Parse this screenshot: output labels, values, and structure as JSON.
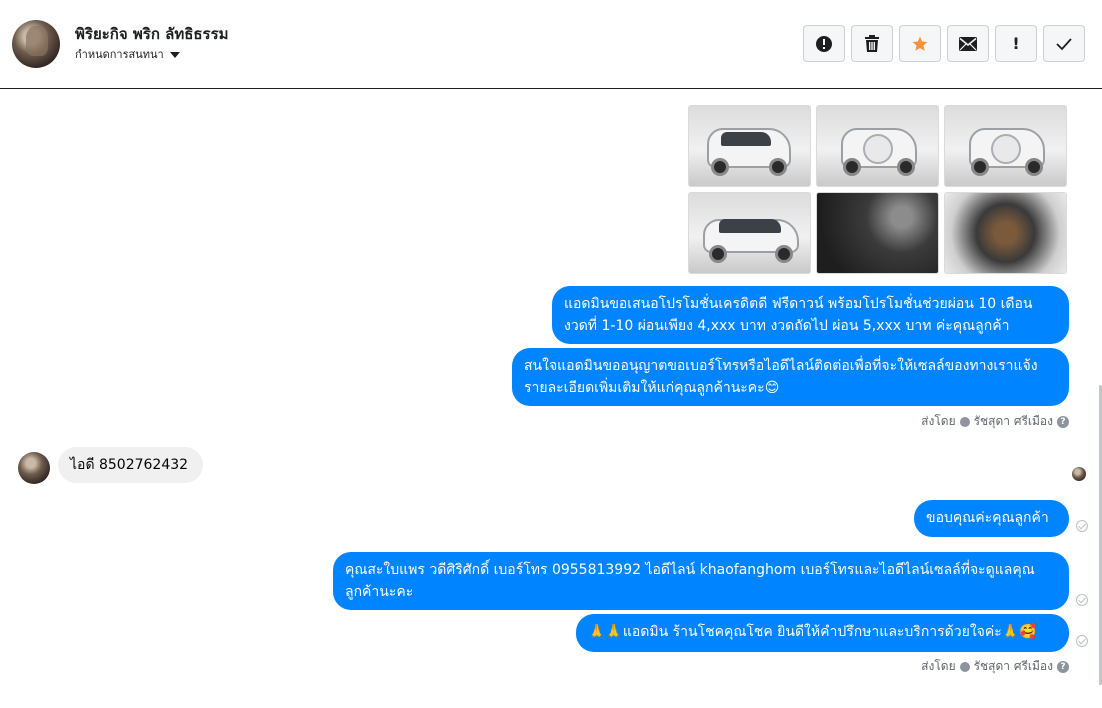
{
  "header": {
    "contact_name": "พิริยะกิจ พริก ลัทธิธรรม",
    "assign_label": "กำหนดการสนทนา",
    "toolbar": [
      {
        "icon": "alert-circle-icon"
      },
      {
        "icon": "trash-icon"
      },
      {
        "icon": "star-icon",
        "color": "#f7923a"
      },
      {
        "icon": "envelope-icon"
      },
      {
        "icon": "exclamation-icon",
        "text": "!"
      },
      {
        "icon": "checkmark-icon"
      }
    ]
  },
  "thread": {
    "photos": [
      {
        "name": "car-front-left-photo"
      },
      {
        "name": "car-front-photo"
      },
      {
        "name": "car-rear-photo"
      },
      {
        "name": "car-side-photo"
      },
      {
        "name": "car-interior-photo"
      },
      {
        "name": "car-engine-photo"
      }
    ],
    "messages": [
      {
        "text": "แอดมินขอเสนอโปรโมชั่นเครดิตดี ฟรีดาวน์ พร้อมโปรโมชั่นช่วยผ่อน 10 เดือน งวดที่ 1-10 ผ่อนเพียง 4,xxx บาท งวดถัดไป ผ่อน 5,xxx บาท ค่ะคุณลูกค้า"
      },
      {
        "text": "สนใจแอดมินขออนุญาตขอเบอร์โทรหรือไอดีไลน์ติดต่อเพื่อที่จะให้เซลล์ของทางเราแจ้งรายละเอียดเพิ่มเติมให้แก่คุณลูกค้านะคะ😊"
      },
      {
        "text": "ไอดี 8502762432"
      },
      {
        "text": "ขอบคุณค่ะคุณลูกค้า"
      },
      {
        "text": "คุณสะใบแพร วดีศิริศักดิ์ เบอร์โทร 0955813992  ไอดีไลน์  khaofanghom   เบอร์โทรและไอดีไลน์เซลล์ที่จะดูแลคุณลูกค้านะคะ"
      },
      {
        "text": "🙏🙏แอดมิน ร้านโชคคุณโชค ยินดีให้คำปรึกษาและบริการด้วยใจค่ะ🙏🥰"
      }
    ],
    "sent_by_label": "ส่งโดย",
    "sent_by_name": "รัชสุดา ศรีเมือง",
    "help_glyph": "?"
  }
}
